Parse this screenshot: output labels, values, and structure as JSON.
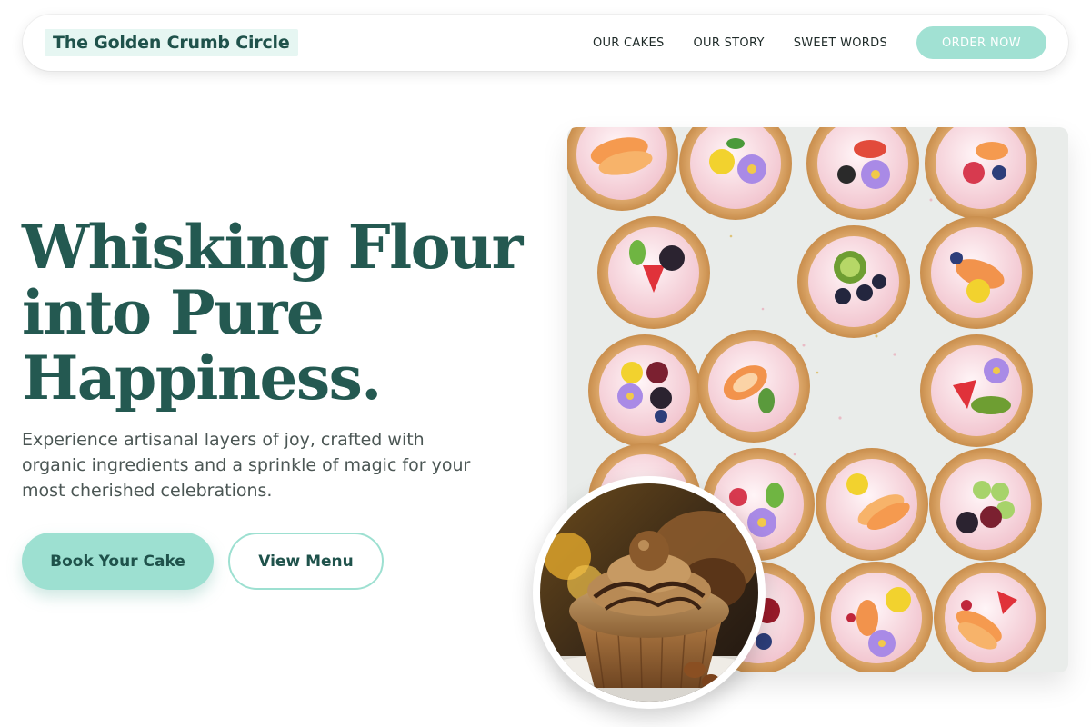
{
  "nav": {
    "brand": "The Golden Crumb Circle",
    "links": [
      "OUR CAKES",
      "OUR STORY",
      "SWEET WORDS"
    ],
    "cta": "ORDER NOW"
  },
  "hero": {
    "title_lines": [
      "Whisking Flour",
      "into Pure",
      "Happiness."
    ],
    "subtitle": "Experience artisanal layers of joy, crafted with organic ingredients and a sprinkle of magic for your most cherished celebrations.",
    "primary_button": "Book Your Cake",
    "secondary_button": "View Menu"
  },
  "colors": {
    "accent": "#9de0d1",
    "heading": "#245951",
    "brand_bg": "#e6f6f2"
  }
}
